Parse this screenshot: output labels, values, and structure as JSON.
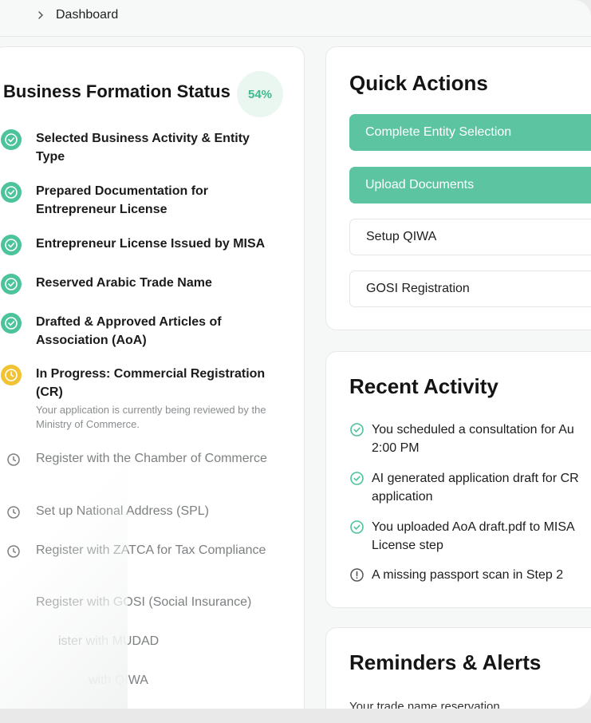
{
  "breadcrumb": {
    "current": "Dashboard"
  },
  "status": {
    "title": "Business Formation Status",
    "percent": "54%",
    "steps": [
      {
        "label": "Selected Business Activity & Entity Type",
        "state": "done"
      },
      {
        "label": "Prepared Documentation for Entrepreneur License",
        "state": "done"
      },
      {
        "label": "Entrepreneur License Issued by MISA",
        "state": "done"
      },
      {
        "label": "Reserved Arabic Trade Name",
        "state": "done"
      },
      {
        "label": "Drafted & Approved Articles of Association (AoA)",
        "state": "done"
      },
      {
        "label": "In Progress: Commercial Registration (CR)",
        "state": "in-progress",
        "description": "Your application is currently being reviewed by the Ministry of Commerce."
      },
      {
        "label": "Register with the Chamber of Commerce",
        "state": "pending"
      },
      {
        "label": "Set up National Address (SPL)",
        "state": "pending"
      },
      {
        "label": "Register with ZATCA for Tax Compliance",
        "state": "pending"
      },
      {
        "label": "Register with GOSI (Social Insurance)",
        "state": "pending"
      },
      {
        "label": "ister with MUDAD",
        "state": "pending"
      },
      {
        "label": "with QIWA",
        "state": "pending"
      }
    ]
  },
  "quick_actions": {
    "title": "Quick Actions",
    "buttons": [
      {
        "label": "Complete Entity Selection",
        "style": "primary"
      },
      {
        "label": "Upload Documents",
        "style": "primary"
      },
      {
        "label": "Setup QIWA",
        "style": "secondary"
      },
      {
        "label": "GOSI Registration",
        "style": "secondary"
      }
    ]
  },
  "recent_activity": {
    "title": "Recent Activity",
    "items": [
      {
        "text": "You scheduled a consultation for Au\n2:00 PM",
        "icon": "check-circle-icon"
      },
      {
        "text": "AI generated application draft for CR\napplication",
        "icon": "check-circle-icon"
      },
      {
        "text": "You uploaded AoA draft.pdf to MISA\nLicense step",
        "icon": "check-circle-icon"
      },
      {
        "text": "A missing passport scan in Step 2",
        "icon": "alert-circle-icon"
      }
    ]
  },
  "reminders": {
    "title": "Reminders & Alerts",
    "first_item": "Your trade name reservation"
  },
  "colors": {
    "accent": "#5cc4a0",
    "done": "#4cc39a",
    "in_progress": "#f1c232",
    "pending": "#8a8d8f"
  }
}
